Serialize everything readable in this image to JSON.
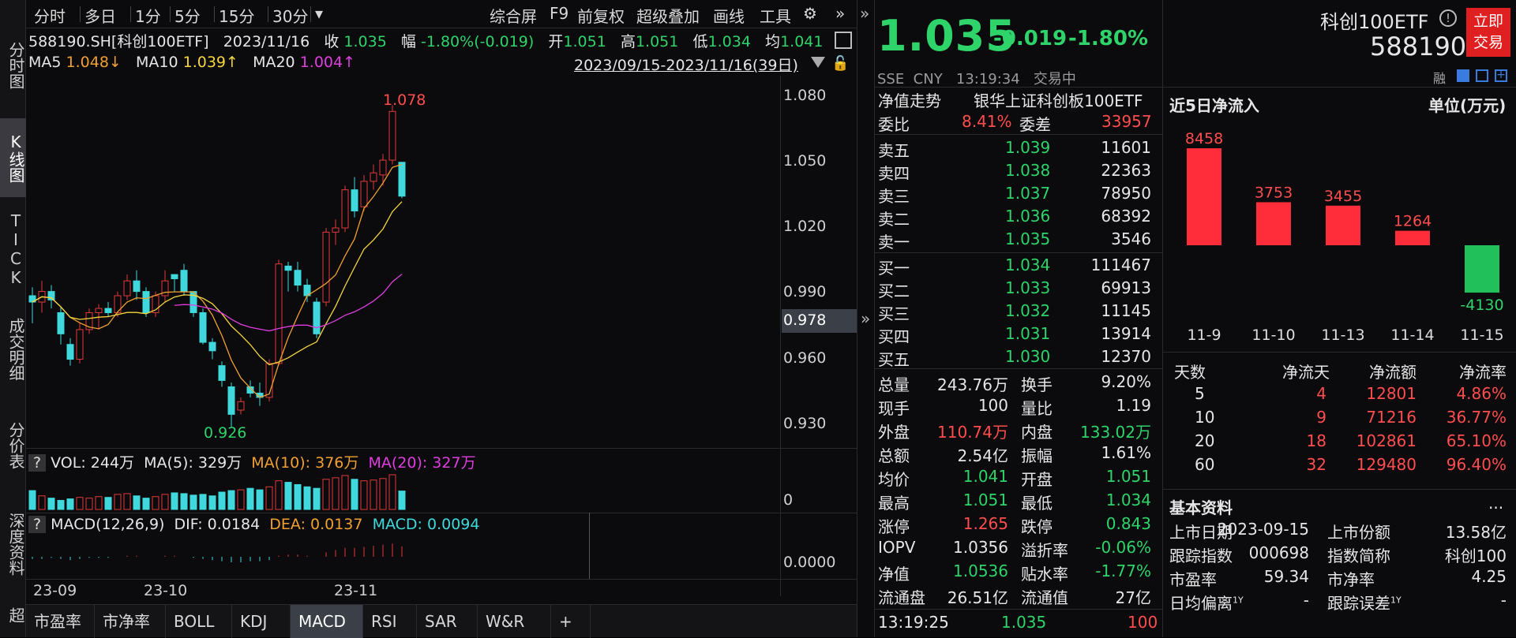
{
  "toolbar": {
    "items": [
      "分时",
      "多日",
      "1分",
      "5分",
      "15分",
      "30分",
      "▾"
    ],
    "right": [
      "综合屏",
      "F9",
      "前复权",
      "超级叠加",
      "画线",
      "工具"
    ]
  },
  "sidetabs": [
    "分时图",
    "K线图",
    "TICK",
    "成交明细",
    "分价表",
    "深度资料",
    "超"
  ],
  "info": {
    "code": "588190.SH[科创100ETF]",
    "date": "2023/11/16",
    "close_l": "收",
    "close": "1.035",
    "chg_l": "幅",
    "chg": "-1.80%(-0.019)",
    "open_l": "开",
    "open": "1.051",
    "high_l": "高",
    "high": "1.051",
    "low_l": "低",
    "low": "1.034",
    "avg_l": "均",
    "avg": "1.041"
  },
  "ma": {
    "ma5_l": "MA5",
    "ma5": "1.048↓",
    "ma10_l": "MA10",
    "ma10": "1.039↑",
    "ma20_l": "MA20",
    "ma20": "1.004↑",
    "range": "2023/09/15-2023/11/16(39日)"
  },
  "yaxis": [
    "1.080",
    "1.050",
    "1.020",
    "0.990",
    "0.960",
    "0.930"
  ],
  "cursor_price": "0.978",
  "hi_label": "1.078",
  "lo_label": "0.926",
  "vol": {
    "q": "?",
    "label": "VOL: 244万",
    "ma5": "MA(5): 329万",
    "ma10": "MA(10): 376万",
    "ma20": "MA(20): 327万",
    "axis": "0"
  },
  "macd": {
    "q": "?",
    "label": "MACD(12,26,9)",
    "dif": "DIF: 0.0184",
    "dea": "DEA: 0.0137",
    "macd": "MACD: 0.0094",
    "axis": "0.0000"
  },
  "xaxis": [
    "23-09",
    "23-10",
    "23-11"
  ],
  "bottomtabs": [
    "市盈率",
    "市净率",
    "BOLL",
    "KDJ",
    "MACD",
    "RSI",
    "SAR",
    "W&R",
    "+"
  ],
  "chart_data": {
    "type": "candlestick",
    "ylim": [
      0.918,
      1.09
    ],
    "candles": [
      [
        0.988,
        0.992,
        0.975,
        0.985
      ],
      [
        0.985,
        0.995,
        0.98,
        0.99
      ],
      [
        0.99,
        0.993,
        0.982,
        0.986
      ],
      [
        0.98,
        0.983,
        0.965,
        0.97
      ],
      [
        0.965,
        0.968,
        0.955,
        0.958
      ],
      [
        0.958,
        0.975,
        0.956,
        0.972
      ],
      [
        0.972,
        0.982,
        0.97,
        0.98
      ],
      [
        0.98,
        0.984,
        0.972,
        0.982
      ],
      [
        0.982,
        0.985,
        0.978,
        0.98
      ],
      [
        0.98,
        0.99,
        0.978,
        0.988
      ],
      [
        0.988,
        0.998,
        0.986,
        0.995
      ],
      [
        0.995,
        1.0,
        0.986,
        0.99
      ],
      [
        0.99,
        0.992,
        0.978,
        0.98
      ],
      [
        0.98,
        0.99,
        0.978,
        0.988
      ],
      [
        0.988,
        1.0,
        0.985,
        0.995
      ],
      [
        0.998,
        0.998,
        0.99,
        0.996
      ],
      [
        1.0,
        1.003,
        0.988,
        0.99
      ],
      [
        0.99,
        0.99,
        0.978,
        0.98
      ],
      [
        0.98,
        0.982,
        0.965,
        0.966
      ],
      [
        0.966,
        0.968,
        0.958,
        0.962
      ],
      [
        0.955,
        0.957,
        0.945,
        0.948
      ],
      [
        0.945,
        0.947,
        0.926,
        0.932
      ],
      [
        0.934,
        0.94,
        0.932,
        0.938
      ],
      [
        0.945,
        0.948,
        0.94,
        0.942
      ],
      [
        0.942,
        0.947,
        0.936,
        0.94
      ],
      [
        0.94,
        0.958,
        0.938,
        0.956
      ],
      [
        0.956,
        1.005,
        0.955,
        1.003
      ],
      [
        1.002,
        1.004,
        0.99,
        1.0
      ],
      [
        1.0,
        1.004,
        0.99,
        0.993
      ],
      [
        0.993,
        0.996,
        0.985,
        0.988
      ],
      [
        0.985,
        0.987,
        0.968,
        0.97
      ],
      [
        0.985,
        1.02,
        0.983,
        1.018
      ],
      [
        1.018,
        1.024,
        1.012,
        1.02
      ],
      [
        1.02,
        1.04,
        1.018,
        1.038
      ],
      [
        1.038,
        1.044,
        1.025,
        1.028
      ],
      [
        1.03,
        1.045,
        1.028,
        1.042
      ],
      [
        1.042,
        1.05,
        1.038,
        1.046
      ],
      [
        1.045,
        1.055,
        1.04,
        1.052
      ],
      [
        1.052,
        1.078,
        1.05,
        1.075
      ],
      [
        1.051,
        1.051,
        1.034,
        1.035
      ]
    ],
    "volumes": [
      250,
      180,
      150,
      120,
      140,
      160,
      150,
      170,
      160,
      200,
      210,
      180,
      150,
      170,
      200,
      220,
      210,
      190,
      200,
      180,
      230,
      250,
      260,
      280,
      260,
      300,
      380,
      360,
      330,
      300,
      280,
      400,
      420,
      450,
      400,
      380,
      390,
      410,
      460,
      244
    ],
    "macd_hist": [
      -0.002,
      -0.002,
      -0.001,
      -0.002,
      -0.003,
      -0.002,
      -0.001,
      -0.001,
      -0.001,
      0.0,
      0.001,
      0.001,
      0.0,
      0.0,
      0.001,
      0.001,
      0.0,
      -0.001,
      -0.002,
      -0.003,
      -0.004,
      -0.005,
      -0.005,
      -0.004,
      -0.004,
      -0.003,
      0.001,
      0.002,
      0.002,
      0.001,
      0.0,
      0.004,
      0.006,
      0.008,
      0.008,
      0.009,
      0.01,
      0.011,
      0.012,
      0.0094
    ]
  },
  "quote": {
    "price": "1.035",
    "chg": "-0.019",
    "pct": "-1.80%",
    "name": "科创100ETF",
    "code": "588190",
    "meta": "SSE  CNY   13:19:34   交易中",
    "trade_btn": "立即交易",
    "rong": "融"
  },
  "orderbook": {
    "nav_l": "净值走势",
    "index": "银华上证科创板100ETF",
    "wb_l": "委比",
    "wb": "8.41%",
    "wc_l": "委差",
    "wc": "33957",
    "asks": [
      [
        "卖五",
        "1.039",
        "11601"
      ],
      [
        "卖四",
        "1.038",
        "22363"
      ],
      [
        "卖三",
        "1.037",
        "78950"
      ],
      [
        "卖二",
        "1.036",
        "68392"
      ],
      [
        "卖一",
        "1.035",
        "3546"
      ]
    ],
    "bids": [
      [
        "买一",
        "1.034",
        "111467"
      ],
      [
        "买二",
        "1.033",
        "69913"
      ],
      [
        "买三",
        "1.032",
        "11145"
      ],
      [
        "买四",
        "1.031",
        "13914"
      ],
      [
        "买五",
        "1.030",
        "12370"
      ]
    ]
  },
  "stats": [
    [
      "总量",
      "243.76万",
      "w",
      "换手",
      "9.20%",
      "w"
    ],
    [
      "现手",
      "100",
      "w",
      "量比",
      "1.19",
      "w"
    ],
    [
      "外盘",
      "110.74万",
      "r",
      "内盘",
      "133.02万",
      "g"
    ],
    [
      "总额",
      "2.54亿",
      "w",
      "振幅",
      "1.61%",
      "w"
    ],
    [
      "均价",
      "1.041",
      "g",
      "开盘",
      "1.051",
      "g"
    ],
    [
      "最高",
      "1.051",
      "g",
      "最低",
      "1.034",
      "g"
    ],
    [
      "涨停",
      "1.265",
      "r",
      "跌停",
      "0.843",
      "g"
    ],
    [
      "IOPV",
      "1.0356",
      "w",
      "溢折率",
      "-0.06%",
      "g"
    ],
    [
      "净值",
      "1.0536",
      "g",
      "贴水率",
      "-1.77%",
      "g"
    ],
    [
      "流通盘",
      "26.51亿",
      "w",
      "流通值",
      "27亿",
      "w"
    ]
  ],
  "tick": {
    "time": "13:19:25",
    "price": "1.035",
    "vol": "100"
  },
  "flow": {
    "title": "近5日净流入",
    "unit": "单位(万元)",
    "labels": [
      "11-9",
      "11-10",
      "11-13",
      "11-14",
      "11-15"
    ],
    "values": [
      8458,
      3753,
      3455,
      1264,
      -4130
    ],
    "value_labels": [
      "8458",
      "3753",
      "3455",
      "1264",
      "-4130"
    ]
  },
  "flowtable": {
    "headers": [
      "天数",
      "净流天",
      "净流额",
      "净流率"
    ],
    "rows": [
      [
        "5",
        "4",
        "12801",
        "4.86%"
      ],
      [
        "10",
        "9",
        "71216",
        "36.77%"
      ],
      [
        "20",
        "18",
        "102861",
        "65.10%"
      ],
      [
        "60",
        "32",
        "129480",
        "96.40%"
      ]
    ]
  },
  "basic": {
    "title": "基本资料",
    "more": "...",
    "rows": [
      [
        "上市日期",
        "2023-09-15",
        "上市份额",
        "13.58亿"
      ],
      [
        "跟踪指数",
        "000698",
        "指数简称",
        "科创100"
      ],
      [
        "市盈率",
        "59.34",
        "市净率",
        "4.25"
      ],
      [
        "日均偏离",
        "-",
        "跟踪误差",
        "-"
      ]
    ],
    "sup": "1Y"
  }
}
